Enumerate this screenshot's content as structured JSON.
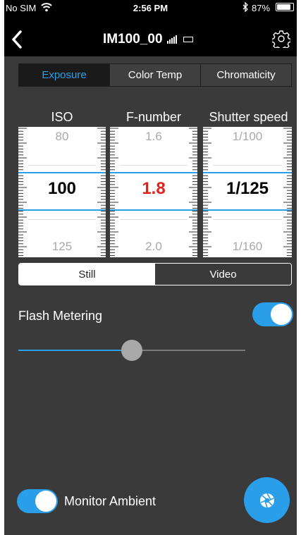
{
  "status_bar": {
    "carrier": "No SIM",
    "time": "2:56 PM",
    "battery_percent": "87%",
    "battery_level": 0.87
  },
  "nav": {
    "title": "IM100_00"
  },
  "tabs": [
    {
      "label": "Exposure",
      "active": true
    },
    {
      "label": "Color Temp",
      "active": false
    },
    {
      "label": "Chromaticity",
      "active": false
    }
  ],
  "dials": [
    {
      "label": "ISO",
      "prev": "80",
      "value": "100",
      "next": "125"
    },
    {
      "label": "F-number",
      "prev": "1.6",
      "value": "1.8",
      "next": "2.0"
    },
    {
      "label": "Shutter speed",
      "prev": "1/100",
      "value": "1/125",
      "next": "1/160"
    }
  ],
  "mode": {
    "options": [
      "Still",
      "Video"
    ],
    "selected": "Still"
  },
  "flash_metering": {
    "label": "Flash Metering",
    "on": true,
    "slider_level": 0.5
  },
  "monitor_ambient": {
    "label": "Monitor Ambient",
    "on": true
  },
  "colors": {
    "accent": "#2a9ee8",
    "highlight_value": "#e0241b",
    "background": "#3a3a3a"
  }
}
